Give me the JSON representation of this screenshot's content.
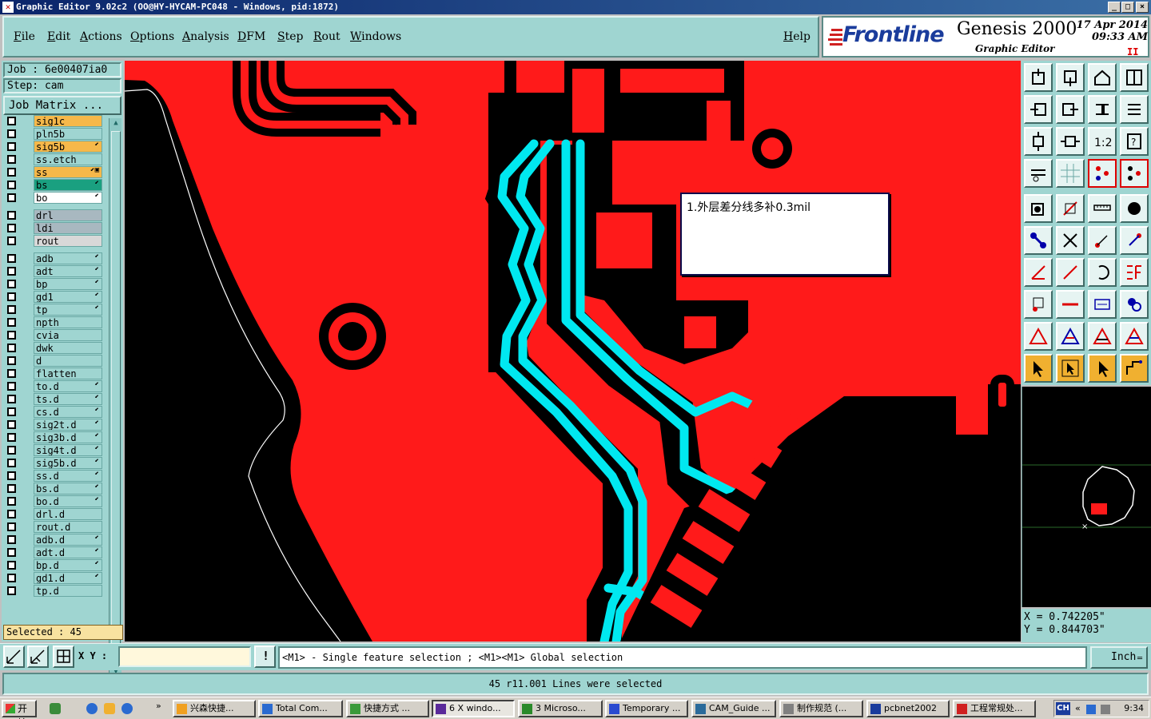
{
  "window": {
    "title": "Graphic Editor 9.02c2  (OO@HY-HYCAM-PC048 - Windows, pid:1872)",
    "buttons": [
      "_",
      "□",
      "×"
    ]
  },
  "menu": {
    "items": [
      "File",
      "Edit",
      "Actions",
      "Options",
      "Analysis",
      "DFM",
      "Step",
      "Rout",
      "Windows"
    ],
    "help": "Help"
  },
  "brand": {
    "logo": "Frontline",
    "product": "Genesis 2000",
    "subtitle": "Graphic Editor",
    "date": "17  Apr  2014",
    "time": "09:33  AM",
    "indicator": "II"
  },
  "job": {
    "job_label": "Job : 6e00407ia0",
    "step_label": "Step: cam",
    "matrix_button": "Job Matrix ..."
  },
  "layers": [
    {
      "name": "sig1c",
      "color": "#f6b84a",
      "flag": ""
    },
    {
      "name": "pln5b",
      "color": "#9fd5d1",
      "flag": ""
    },
    {
      "name": "sig5b",
      "color": "#f6b84a",
      "flag": "⬋"
    },
    {
      "name": "ss.etch",
      "color": "#9fd5d1",
      "flag": ""
    },
    {
      "name": "ss",
      "color": "#f6b84a",
      "flag": "⬋▣"
    },
    {
      "name": "bs",
      "color": "#1aa080",
      "flag": "⬋"
    },
    {
      "name": "bo",
      "color": "#ffffff",
      "flag": "⬋"
    },
    {
      "name": "drl",
      "color": "#a8b8c0",
      "flag": ""
    },
    {
      "name": "ldi",
      "color": "#a8b8c0",
      "flag": ""
    },
    {
      "name": "rout",
      "color": "#d8d8d8",
      "flag": ""
    },
    {
      "name": "adb",
      "color": "#9fd5d1",
      "flag": "⬋"
    },
    {
      "name": "adt",
      "color": "#9fd5d1",
      "flag": "⬋"
    },
    {
      "name": "bp",
      "color": "#9fd5d1",
      "flag": "⬋"
    },
    {
      "name": "gd1",
      "color": "#9fd5d1",
      "flag": "⬋"
    },
    {
      "name": "tp",
      "color": "#9fd5d1",
      "flag": "⬋"
    },
    {
      "name": "npth",
      "color": "#9fd5d1",
      "flag": ""
    },
    {
      "name": "cvia",
      "color": "#9fd5d1",
      "flag": ""
    },
    {
      "name": "dwk",
      "color": "#9fd5d1",
      "flag": ""
    },
    {
      "name": "d",
      "color": "#9fd5d1",
      "flag": ""
    },
    {
      "name": "flatten",
      "color": "#9fd5d1",
      "flag": ""
    },
    {
      "name": "to.d",
      "color": "#9fd5d1",
      "flag": "⬋"
    },
    {
      "name": "ts.d",
      "color": "#9fd5d1",
      "flag": "⬋"
    },
    {
      "name": "cs.d",
      "color": "#9fd5d1",
      "flag": "⬋"
    },
    {
      "name": "sig2t.d",
      "color": "#9fd5d1",
      "flag": "⬋"
    },
    {
      "name": "sig3b.d",
      "color": "#9fd5d1",
      "flag": "⬋"
    },
    {
      "name": "sig4t.d",
      "color": "#9fd5d1",
      "flag": "⬋"
    },
    {
      "name": "sig5b.d",
      "color": "#9fd5d1",
      "flag": "⬋"
    },
    {
      "name": "ss.d",
      "color": "#9fd5d1",
      "flag": "⬋"
    },
    {
      "name": "bs.d",
      "color": "#9fd5d1",
      "flag": "⬋"
    },
    {
      "name": "bo.d",
      "color": "#9fd5d1",
      "flag": "⬋"
    },
    {
      "name": "drl.d",
      "color": "#9fd5d1",
      "flag": ""
    },
    {
      "name": "rout.d",
      "color": "#9fd5d1",
      "flag": ""
    },
    {
      "name": "adb.d",
      "color": "#9fd5d1",
      "flag": "⬋"
    },
    {
      "name": "adt.d",
      "color": "#9fd5d1",
      "flag": "⬋"
    },
    {
      "name": "bp.d",
      "color": "#9fd5d1",
      "flag": "⬋"
    },
    {
      "name": "gd1.d",
      "color": "#9fd5d1",
      "flag": "⬋"
    },
    {
      "name": "tp.d",
      "color": "#9fd5d1",
      "flag": ""
    }
  ],
  "selected_count": "Selected : 45",
  "canvas": {
    "note": "1.外层差分线多补0.3mil",
    "copper_color": "#ff1a1a",
    "selected_color": "#00e8f0",
    "background_color": "#000000"
  },
  "coords": {
    "x": "X =  0.742205\"",
    "y": "Y =  0.844703\""
  },
  "command": {
    "xy_label": "X Y :",
    "xy_value": "",
    "hint": "<M1> - Single feature selection ; <M1><M1> Global selection",
    "units": "Inch"
  },
  "status": "45 r11.001 Lines were selected",
  "taskbar": {
    "start": "开始",
    "tasks": [
      "兴森快捷...",
      "Total Com...",
      "快捷方式 ...",
      "6 X windo...",
      "3 Microso...",
      "Temporary ...",
      "CAM_Guide ...",
      "制作规范 (...",
      "pcbnet2002",
      "工程常规处..."
    ],
    "lang": "CH",
    "clock": "9:34"
  }
}
